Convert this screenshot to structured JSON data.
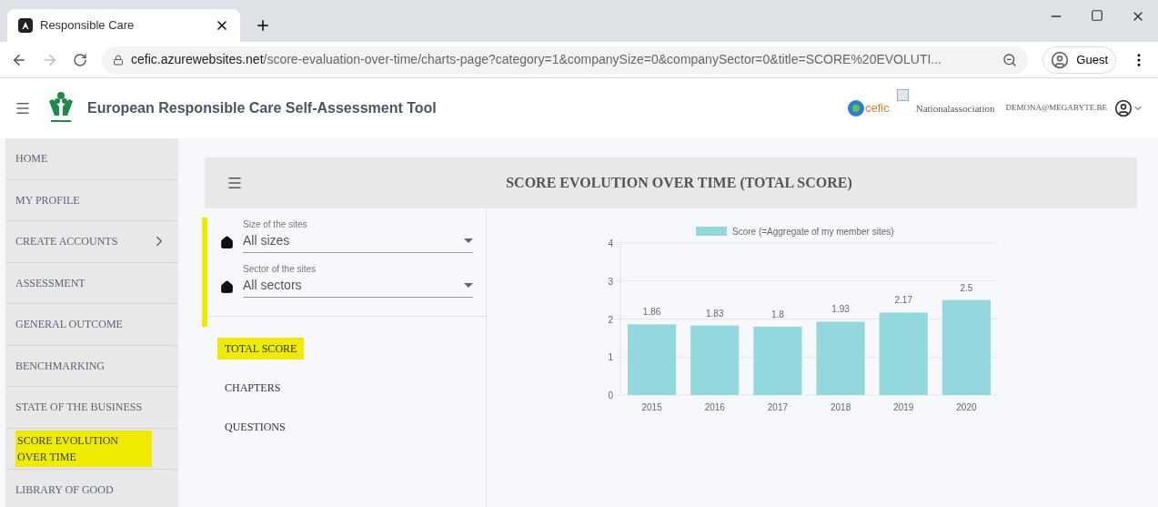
{
  "browser": {
    "tab_title": "Responsible Care",
    "url_host": "cefic.azurewebsites.net",
    "url_path": "/score-evaluation-over-time/charts-page?category=1&companySize=0&companySector=0&title=SCORE%20EVOLUTI...",
    "profile": "Guest"
  },
  "header": {
    "title": "European Responsible Care Self-Assessment Tool",
    "partner_logo": "cefic",
    "association": "Nationalassociation",
    "user": "DEMONA@MEGABYTE.BE"
  },
  "sidebar": {
    "items": [
      {
        "label": "HOME",
        "highlighted": false,
        "submenu": false
      },
      {
        "label": "MY PROFILE",
        "highlighted": false,
        "submenu": false
      },
      {
        "label": "CREATE ACCOUNTS",
        "highlighted": false,
        "submenu": true
      },
      {
        "label": "ASSESSMENT",
        "highlighted": false,
        "submenu": false
      },
      {
        "label": "GENERAL OUTCOME",
        "highlighted": false,
        "submenu": false
      },
      {
        "label": "BENCHMARKING",
        "highlighted": false,
        "submenu": false
      },
      {
        "label": "STATE OF THE BUSINESS",
        "highlighted": false,
        "submenu": false
      },
      {
        "label": "SCORE EVOLUTION OVER TIME",
        "highlighted": true,
        "submenu": false
      },
      {
        "label": "LIBRARY OF GOOD",
        "highlighted": false,
        "submenu": false
      }
    ]
  },
  "panel": {
    "title": "SCORE EVOLUTION OVER TIME (TOTAL SCORE)",
    "filters": [
      {
        "label": "Size of the sites",
        "value": "All sizes"
      },
      {
        "label": "Sector of the sites",
        "value": "All sectors"
      }
    ],
    "filters_marked": true,
    "categories": [
      {
        "label": "TOTAL SCORE",
        "highlighted": true
      },
      {
        "label": "CHAPTERS",
        "highlighted": false
      },
      {
        "label": "QUESTIONS",
        "highlighted": false
      }
    ],
    "chart_data": {
      "type": "bar",
      "categories": [
        "2015",
        "2016",
        "2017",
        "2018",
        "2019",
        "2020"
      ],
      "series": [
        {
          "name": "Score (=Aggregate of my member sites)",
          "color": "#93d8dc",
          "values": [
            1.86,
            1.83,
            1.8,
            1.93,
            2.17,
            2.5
          ]
        }
      ],
      "ylim": [
        0,
        4
      ],
      "grid": true,
      "yticks": [
        0,
        1,
        2,
        3,
        4
      ],
      "data_labels": true
    }
  }
}
